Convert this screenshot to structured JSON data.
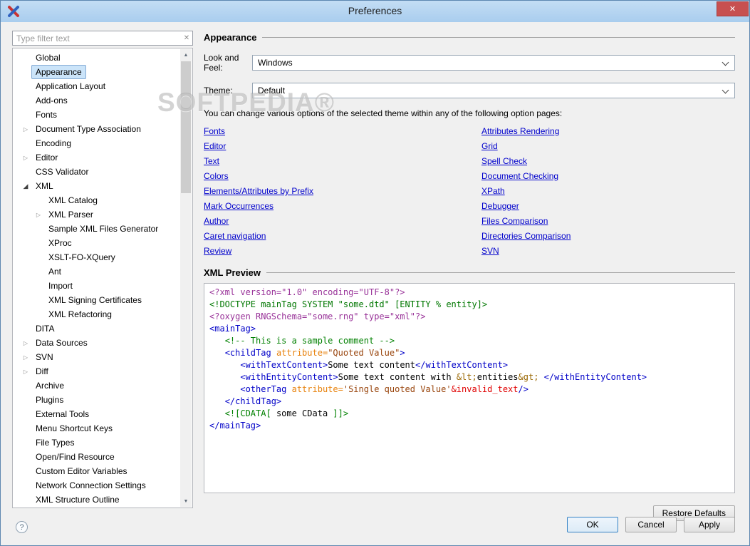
{
  "window": {
    "title": "Preferences"
  },
  "icons": {
    "close": "✕",
    "clear": "✕",
    "collapsed": "▷",
    "expanded": "◢",
    "scroll_up": "▲",
    "scroll_down": "▼",
    "help": "?"
  },
  "watermark": "SOFTPEDIA®",
  "sidebar": {
    "filter_placeholder": "Type filter text",
    "items": [
      {
        "label": "Global",
        "level": 0,
        "arrow": "none",
        "selected": false
      },
      {
        "label": "Appearance",
        "level": 0,
        "arrow": "none",
        "selected": true
      },
      {
        "label": "Application Layout",
        "level": 0,
        "arrow": "none",
        "selected": false
      },
      {
        "label": "Add-ons",
        "level": 0,
        "arrow": "none",
        "selected": false
      },
      {
        "label": "Fonts",
        "level": 0,
        "arrow": "none",
        "selected": false
      },
      {
        "label": "Document Type Association",
        "level": 0,
        "arrow": "collapsed",
        "selected": false
      },
      {
        "label": "Encoding",
        "level": 0,
        "arrow": "none",
        "selected": false
      },
      {
        "label": "Editor",
        "level": 0,
        "arrow": "collapsed",
        "selected": false
      },
      {
        "label": "CSS Validator",
        "level": 0,
        "arrow": "none",
        "selected": false
      },
      {
        "label": "XML",
        "level": 0,
        "arrow": "expanded",
        "selected": false
      },
      {
        "label": "XML Catalog",
        "level": 1,
        "arrow": "none",
        "selected": false
      },
      {
        "label": "XML Parser",
        "level": 1,
        "arrow": "collapsed",
        "selected": false
      },
      {
        "label": "Sample XML Files Generator",
        "level": 1,
        "arrow": "none",
        "selected": false
      },
      {
        "label": "XProc",
        "level": 1,
        "arrow": "none",
        "selected": false
      },
      {
        "label": "XSLT-FO-XQuery",
        "level": 1,
        "arrow": "none",
        "selected": false
      },
      {
        "label": "Ant",
        "level": 1,
        "arrow": "none",
        "selected": false
      },
      {
        "label": "Import",
        "level": 1,
        "arrow": "none",
        "selected": false
      },
      {
        "label": "XML Signing Certificates",
        "level": 1,
        "arrow": "none",
        "selected": false
      },
      {
        "label": "XML Refactoring",
        "level": 1,
        "arrow": "none",
        "selected": false
      },
      {
        "label": "DITA",
        "level": 0,
        "arrow": "none",
        "selected": false
      },
      {
        "label": "Data Sources",
        "level": 0,
        "arrow": "collapsed",
        "selected": false
      },
      {
        "label": "SVN",
        "level": 0,
        "arrow": "collapsed",
        "selected": false
      },
      {
        "label": "Diff",
        "level": 0,
        "arrow": "collapsed",
        "selected": false
      },
      {
        "label": "Archive",
        "level": 0,
        "arrow": "none",
        "selected": false
      },
      {
        "label": "Plugins",
        "level": 0,
        "arrow": "none",
        "selected": false
      },
      {
        "label": "External Tools",
        "level": 0,
        "arrow": "none",
        "selected": false
      },
      {
        "label": "Menu Shortcut Keys",
        "level": 0,
        "arrow": "none",
        "selected": false
      },
      {
        "label": "File Types",
        "level": 0,
        "arrow": "none",
        "selected": false
      },
      {
        "label": "Open/Find Resource",
        "level": 0,
        "arrow": "none",
        "selected": false
      },
      {
        "label": "Custom Editor Variables",
        "level": 0,
        "arrow": "none",
        "selected": false
      },
      {
        "label": "Network Connection Settings",
        "level": 0,
        "arrow": "none",
        "selected": false
      },
      {
        "label": "XML Structure Outline",
        "level": 0,
        "arrow": "none",
        "selected": false
      }
    ]
  },
  "main": {
    "section_title": "Appearance",
    "look_and_feel_label": "Look and Feel:",
    "look_and_feel_value": "Windows",
    "theme_label": "Theme:",
    "theme_value": "Default",
    "instruction": "You can change various options of the selected theme within any of the following option pages:",
    "links_left": [
      "Fonts",
      "Editor",
      "Text",
      "Colors",
      "Elements/Attributes by Prefix",
      "Mark Occurrences",
      "Author",
      "Caret navigation",
      "Review"
    ],
    "links_right": [
      "Attributes Rendering",
      "Grid",
      "Spell Check",
      "Document Checking",
      "XPath",
      "Debugger",
      "Files Comparison",
      "Directories Comparison",
      "SVN"
    ],
    "preview_title": "XML Preview",
    "restore_defaults_label": "Restore Defaults"
  },
  "xml_preview_lines": [
    [
      {
        "t": "<?xml version=\"1.0\" encoding=\"UTF-8\"?>",
        "c": "pi"
      }
    ],
    [
      {
        "t": "<!DOCTYPE mainTag SYSTEM \"some.dtd\" [ENTITY % entity]>",
        "c": "doctype"
      }
    ],
    [
      {
        "t": "<?oxygen RNGSchema=\"some.rng\" type=\"xml\"?>",
        "c": "pi"
      }
    ],
    [
      {
        "t": "<mainTag>",
        "c": "tag"
      }
    ],
    [
      {
        "t": "   ",
        "c": "plain"
      },
      {
        "t": "<!-- This is a sample comment -->",
        "c": "comment"
      }
    ],
    [
      {
        "t": "   ",
        "c": "plain"
      },
      {
        "t": "<childTag ",
        "c": "tag"
      },
      {
        "t": "attribute=",
        "c": "attr"
      },
      {
        "t": "\"Quoted Value\"",
        "c": "value"
      },
      {
        "t": ">",
        "c": "tag"
      }
    ],
    [
      {
        "t": "      ",
        "c": "plain"
      },
      {
        "t": "<withTextContent>",
        "c": "tag"
      },
      {
        "t": "Some text content",
        "c": "plain"
      },
      {
        "t": "</withTextContent>",
        "c": "tag"
      }
    ],
    [
      {
        "t": "      ",
        "c": "plain"
      },
      {
        "t": "<withEntityContent>",
        "c": "tag"
      },
      {
        "t": "Some text content with ",
        "c": "plain"
      },
      {
        "t": "&lt;",
        "c": "entity"
      },
      {
        "t": "entities",
        "c": "plain"
      },
      {
        "t": "&gt;",
        "c": "entity"
      },
      {
        "t": " ",
        "c": "plain"
      },
      {
        "t": "</withEntityContent>",
        "c": "tag"
      }
    ],
    [
      {
        "t": "      ",
        "c": "plain"
      },
      {
        "t": "<otherTag ",
        "c": "tag"
      },
      {
        "t": "attribute=",
        "c": "attr"
      },
      {
        "t": "'Single quoted Value'",
        "c": "value"
      },
      {
        "t": "&invalid_text",
        "c": "invalid"
      },
      {
        "t": "/>",
        "c": "tag"
      }
    ],
    [
      {
        "t": "   ",
        "c": "plain"
      },
      {
        "t": "</childTag>",
        "c": "tag"
      }
    ],
    [
      {
        "t": "   ",
        "c": "plain"
      },
      {
        "t": "<![CDATA[ ",
        "c": "cdata"
      },
      {
        "t": "some CData",
        "c": "cdatacontent"
      },
      {
        "t": " ]]>",
        "c": "cdata"
      }
    ],
    [
      {
        "t": "</mainTag>",
        "c": "tag"
      }
    ]
  ],
  "footer": {
    "ok_label": "OK",
    "cancel_label": "Cancel",
    "apply_label": "Apply"
  }
}
